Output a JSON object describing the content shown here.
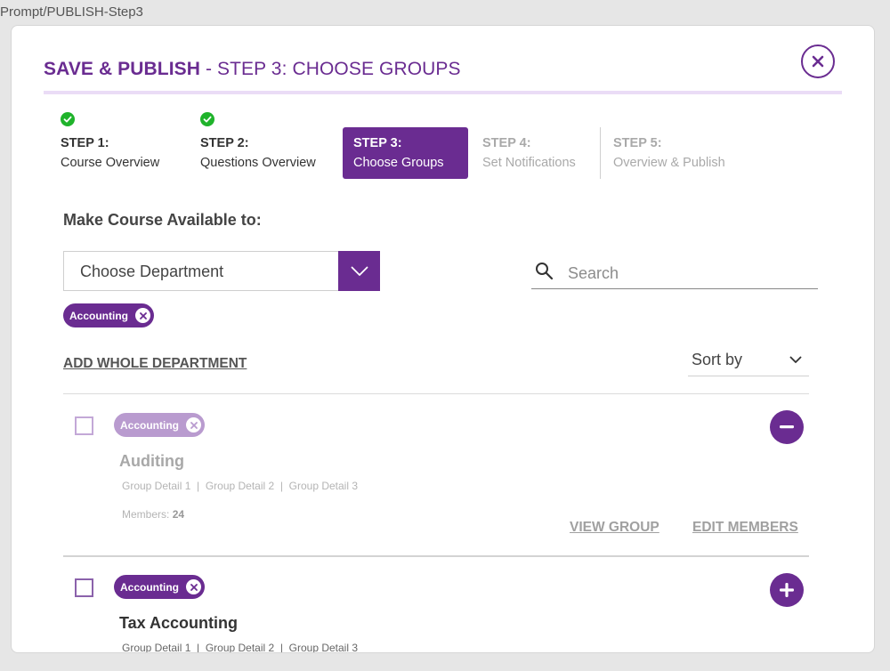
{
  "frame_label": "Prompt/PUBLISH-Step3",
  "modal": {
    "title_bold": "SAVE & PUBLISH",
    "title_rest": " - STEP 3: CHOOSE GROUPS",
    "close_icon": "close-icon"
  },
  "steps": [
    {
      "num": "STEP 1:",
      "label": "Course Overview",
      "status": "done"
    },
    {
      "num": "STEP 2:",
      "label": "Questions Overview",
      "status": "done"
    },
    {
      "num": "STEP 3:",
      "label": "Choose Groups",
      "status": "active"
    },
    {
      "num": "STEP 4:",
      "label": "Set Notifications",
      "status": "pending"
    },
    {
      "num": "STEP 5:",
      "label": "Overview & Publish",
      "status": "pending"
    }
  ],
  "available": {
    "heading": "Make Course Available to:",
    "department_select": "Choose Department",
    "selected_chip": "Accounting"
  },
  "search": {
    "placeholder": "Search",
    "icon": "search-icon"
  },
  "add_whole_department": "ADD WHOLE DEPARTMENT",
  "sort": {
    "label": "Sort by"
  },
  "groups": [
    {
      "tag": "Accounting",
      "title": "Auditing",
      "details": "Group Detail 1  |  Group Detail 2  |  Group Detail 3",
      "members_label": "Members: ",
      "members_count": "24",
      "view_group": "VIEW GROUP",
      "edit_members": "EDIT MEMBERS",
      "action": "remove"
    },
    {
      "tag": "Accounting",
      "title": "Tax Accounting",
      "details": "Group Detail 1  |  Group Detail 2  |  Group Detail 3",
      "action": "add"
    }
  ],
  "colors": {
    "accent": "#6a2c91",
    "check": "#1fb32b",
    "accent_light": "#eadcf6"
  }
}
